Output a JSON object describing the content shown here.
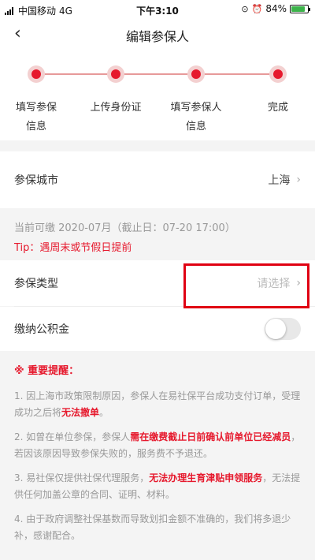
{
  "status_bar": {
    "carrier": "中国移动",
    "network": "4G",
    "time": "下午3:10",
    "battery_percent": "84%",
    "battery_level": 0.84
  },
  "nav": {
    "back_icon": "chevron-left-icon",
    "title": "编辑参保人"
  },
  "steps": [
    {
      "label": "填写参保信息"
    },
    {
      "label": "上传身份证"
    },
    {
      "label": "填写参保人信息"
    },
    {
      "label": "完成"
    }
  ],
  "city_row": {
    "label": "参保城市",
    "value": "上海"
  },
  "notice": {
    "date_text": "当前可缴 2020-07月（截止日：07-20 17:00）",
    "tip_text": "Tip：遇周末或节假日提前"
  },
  "type_row": {
    "label": "参保类型",
    "placeholder": "请选择"
  },
  "fund_row": {
    "label": "缴纳公积金",
    "enabled": false
  },
  "reminders": {
    "heading": "※ 重要提醒：",
    "items": [
      {
        "a": "1. 因上海市政策限制原因，参保人在易社保平台成功支付订单，受理成功之后将",
        "b": "无法撤单",
        "c": "。",
        "d": "",
        "e": ""
      },
      {
        "a": "2. 如曾在单位参保，参保人",
        "b": "需在缴费截止日前确认前单位已经减员",
        "c": "，若因该原因导致参保失败的，服务费不予退还。",
        "d": "",
        "e": ""
      },
      {
        "a": "3. 易社保仅提供社保代理服务，",
        "b": "无法办理生育津贴申领服务",
        "c": "，无法提供任何加盖公章的合同、证明、材料。",
        "d": "",
        "e": ""
      },
      {
        "a": "4. 由于政府调整社保基数而导致划扣金额不准确的，我们将多退少补，感谢配合。",
        "b": "",
        "c": "",
        "d": "",
        "e": ""
      }
    ]
  }
}
